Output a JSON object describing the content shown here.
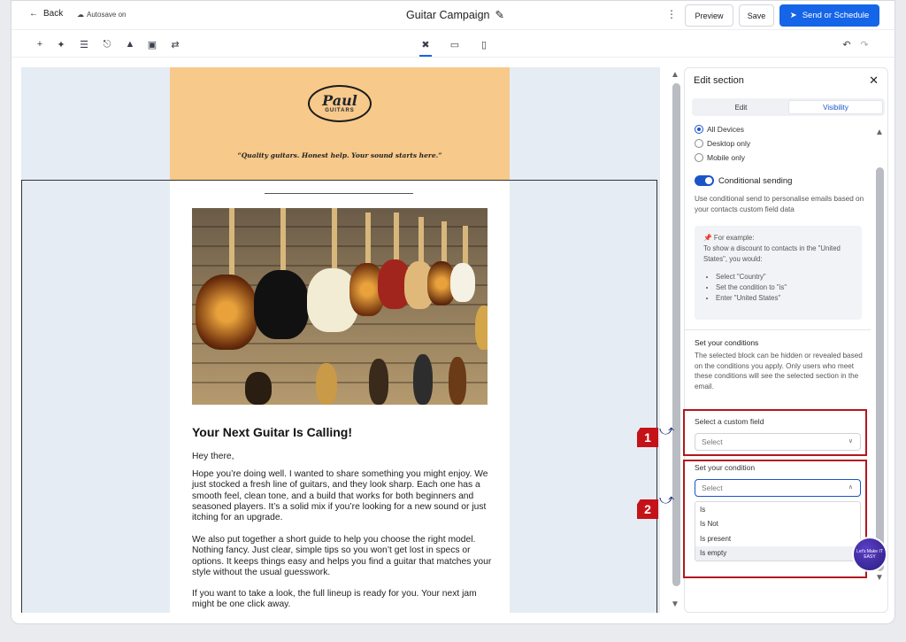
{
  "topbar": {
    "back": "Back",
    "autosave": "Autosave on",
    "title": "Guitar Campaign",
    "preview": "Preview",
    "save": "Save",
    "send": "Send or Schedule"
  },
  "email": {
    "logo_line1": "Paul",
    "logo_line2": "GUITARS",
    "tagline": "“Quality guitars. Honest help. Your sound starts here.”",
    "heading": "Your Next Guitar Is Calling!",
    "greeting": "Hey there,",
    "p1": "Hope you’re doing well. I wanted to share something you might enjoy. We just stocked a fresh line of guitars, and they look sharp. Each one has a smooth feel, clean tone, and a build that works for both beginners and seasoned players. It’s a solid mix if you’re looking for a new sound or just itching for an upgrade.",
    "p2": "We also put together a short guide to help you choose the right model. Nothing fancy. Just clear, simple tips so you won’t get lost in specs or options. It keeps things easy and helps you find a guitar that matches your style without the usual guesswork.",
    "p3": "If you want to take a look, the full lineup is ready for you. Your next jam might be one click away."
  },
  "panel": {
    "title": "Edit section",
    "tab_edit": "Edit",
    "tab_visibility": "Visibility",
    "radio_all": "All Devices",
    "radio_desktop": "Desktop only",
    "radio_mobile": "Mobile only",
    "conditional_label": "Conditional sending",
    "conditional_desc": "Use conditional send to personalise emails based on your contacts custom field data",
    "example_title": "For example:",
    "example_desc": "To show a discount to contacts in the \"United States\", you would:",
    "example_steps": [
      "Select \"Country\"",
      "Set the condition to \"is\"",
      "Enter \"United States\""
    ],
    "set_conditions_title": "Set your conditions",
    "set_conditions_desc": "The selected block can be hidden or revealed based on the conditions you apply. Only users who meet these conditions will see the selected section in the email.",
    "custom_field_label": "Select a custom field",
    "custom_field_placeholder": "Select",
    "condition_label": "Set your condition",
    "condition_placeholder": "Select",
    "condition_options": [
      "Is",
      "Is Not",
      "Is present",
      "Is empty"
    ]
  },
  "annotations": {
    "marker1": "1",
    "marker2": "2",
    "badge": "Let's Make IT EASY"
  },
  "colors": {
    "accent": "#1565e8",
    "header_bg": "#f7c98a",
    "annotation_red": "#b3171e"
  }
}
